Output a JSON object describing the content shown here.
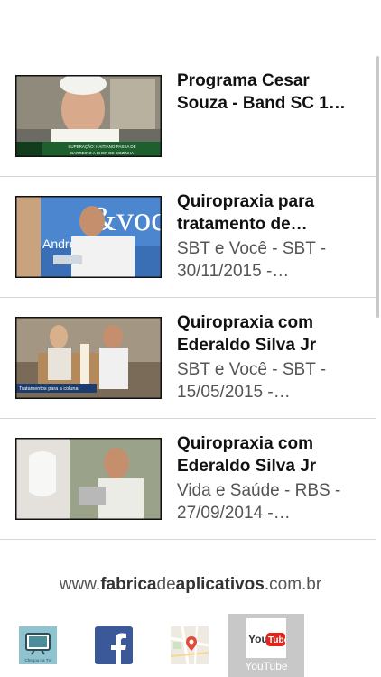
{
  "videos": [
    {
      "title": "Programa Cesar\nSouza - Band SC 1…",
      "subtitle": "",
      "thumb_caption": "SUPERAÇÃO: HAITIANO PASSA DE\nCARREIRO A CHEF DE COZINHA"
    },
    {
      "title": "Quiropraxia para\ntratamento de…",
      "subtitle": "SBT e Você - SBT -\n30/11/2015 -…",
      "thumb_caption": "t&você Andre…to"
    },
    {
      "title": "Quiropraxia com\nEderaldo Silva Jr",
      "subtitle": "SBT e Você - SBT -\n15/05/2015 -…",
      "thumb_caption": "Tratamentos para a coluna"
    },
    {
      "title": "Quiropraxia com\nEderaldo Silva Jr",
      "subtitle": "Vida e Saúde - RBS -\n27/09/2014 -…",
      "thumb_caption": ""
    }
  ],
  "footer": {
    "url_prefix": "www.",
    "url_brand1": "fabrica",
    "url_mid": "de",
    "url_brand2": "aplicativos",
    "url_suffix": ".com.br"
  },
  "tabs": [
    {
      "label": "Chegou na TV",
      "icon": "tv-icon",
      "active": false
    },
    {
      "label": "",
      "icon": "facebook-icon",
      "active": false
    },
    {
      "label": "",
      "icon": "map-icon",
      "active": false
    },
    {
      "label": "YouTube",
      "icon": "youtube-icon",
      "active": true
    }
  ],
  "colors": {
    "facebook": "#3b5998",
    "youtube_red": "#e62117",
    "active_tab": "#c8c8c8"
  }
}
